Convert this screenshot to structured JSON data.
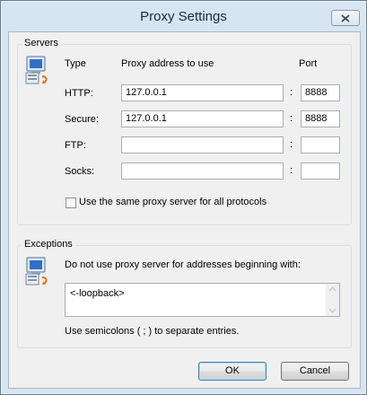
{
  "window": {
    "title": "Proxy Settings"
  },
  "servers": {
    "group_label": "Servers",
    "headers": {
      "type": "Type",
      "address": "Proxy address to use",
      "port": "Port"
    },
    "rows": [
      {
        "label": "HTTP:",
        "address": "127.0.0.1",
        "port": "8888"
      },
      {
        "label": "Secure:",
        "address": "127.0.0.1",
        "port": "8888"
      },
      {
        "label": "FTP:",
        "address": "",
        "port": ""
      },
      {
        "label": "Socks:",
        "address": "",
        "port": ""
      }
    ],
    "colon": ":",
    "same_proxy_label": "Use the same proxy server for all protocols",
    "same_proxy_checked": false
  },
  "exceptions": {
    "group_label": "Exceptions",
    "description": "Do not use proxy server for addresses beginning with:",
    "value": "<-loopback>",
    "hint": "Use semicolons ( ; ) to separate entries."
  },
  "buttons": {
    "ok": "OK",
    "cancel": "Cancel"
  },
  "icons": {
    "close": "close-icon",
    "servers": "network-computer-icon",
    "exceptions": "network-computer-icon"
  }
}
